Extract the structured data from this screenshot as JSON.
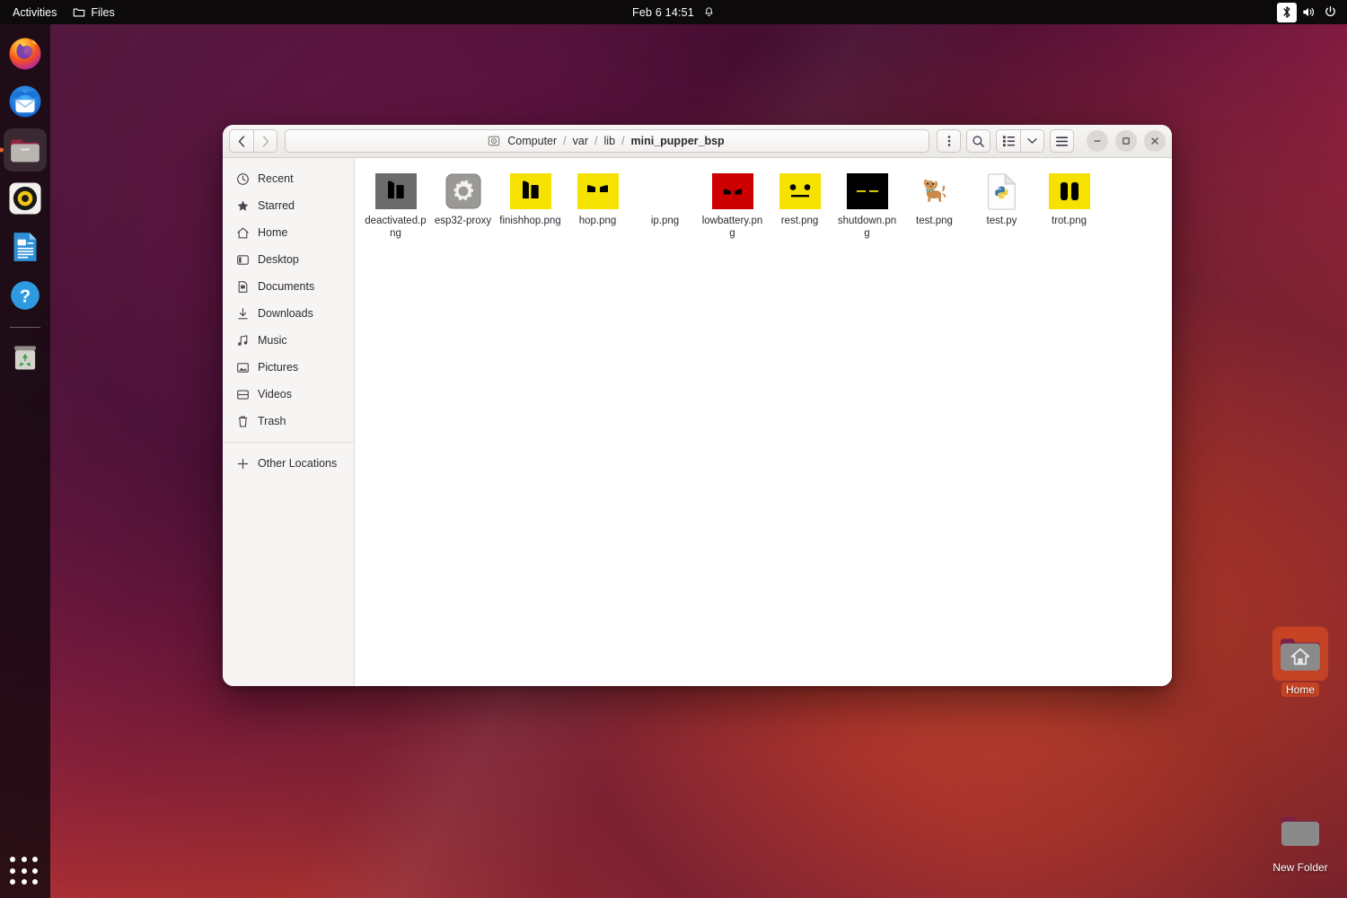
{
  "topbar": {
    "activities_label": "Activities",
    "app_name": "Files",
    "app_icon": "folder-icon",
    "clock": "Feb 6  14:51",
    "notification_icon": "bell-icon",
    "tray": [
      {
        "name": "bluetooth-icon",
        "active": true
      },
      {
        "name": "volume-icon",
        "active": false
      },
      {
        "name": "power-icon",
        "active": false
      }
    ]
  },
  "dock": {
    "items": [
      {
        "name": "firefox",
        "label": "Firefox",
        "running": false
      },
      {
        "name": "thunderbird",
        "label": "Thunderbird",
        "running": false
      },
      {
        "name": "files",
        "label": "Files",
        "running": true
      },
      {
        "name": "rhythmbox",
        "label": "Rhythmbox",
        "running": false
      },
      {
        "name": "libreoffice-writer",
        "label": "LibreOffice Writer",
        "running": false
      },
      {
        "name": "help",
        "label": "Help",
        "running": false
      },
      {
        "name": "trash",
        "label": "Trash",
        "running": false
      }
    ],
    "show_apps_label": "Show Applications"
  },
  "desktop_icons": [
    {
      "name": "home",
      "label": "Home",
      "selected": true
    },
    {
      "name": "new-folder",
      "label": "New Folder",
      "selected": false
    }
  ],
  "window": {
    "title": "mini_pupper_bsp",
    "nav": {
      "back_label": "‹",
      "forward_label": "›"
    },
    "pathbar": {
      "drive_icon": "computer-icon",
      "crumbs": [
        {
          "label": "Computer",
          "current": false
        },
        {
          "label": "var",
          "current": false
        },
        {
          "label": "lib",
          "current": false
        },
        {
          "label": "mini_pupper_bsp",
          "current": true
        }
      ],
      "separator": "/"
    },
    "toolbar": {
      "menu_icon": "vertical-dots-icon",
      "search_icon": "search-icon",
      "list_view_icon": "list-view-icon",
      "view_dropdown_icon": "chevron-down-icon",
      "hamburger_icon": "hamburger-menu-icon",
      "minimize_icon": "minimize-icon",
      "maximize_icon": "maximize-icon",
      "close_icon": "close-icon"
    }
  },
  "sidebar": {
    "items": [
      {
        "label": "Recent",
        "icon": "clock-icon"
      },
      {
        "label": "Starred",
        "icon": "star-icon"
      },
      {
        "label": "Home",
        "icon": "home-icon"
      },
      {
        "label": "Desktop",
        "icon": "desktop-icon"
      },
      {
        "label": "Documents",
        "icon": "document-icon"
      },
      {
        "label": "Downloads",
        "icon": "download-icon"
      },
      {
        "label": "Music",
        "icon": "music-note-icon"
      },
      {
        "label": "Pictures",
        "icon": "picture-icon"
      },
      {
        "label": "Videos",
        "icon": "video-icon"
      },
      {
        "label": "Trash",
        "icon": "trash-icon"
      }
    ],
    "other_locations": {
      "label": "Other Locations",
      "icon": "plus-icon"
    }
  },
  "files": [
    {
      "name": "deactivated.png",
      "thumb": "gray-two-blobs",
      "bg": "#6b6b6b"
    },
    {
      "name": "esp32-proxy",
      "thumb": "gear-folder-icon",
      "bg": "#9a9996"
    },
    {
      "name": "finishhop.png",
      "thumb": "yellow-two-blobs",
      "bg": "#f5e200"
    },
    {
      "name": "hop.png",
      "thumb": "yellow-two-brows",
      "bg": "#f5e200"
    },
    {
      "name": "ip.png",
      "thumb": "blank-white",
      "bg": "#ffffff"
    },
    {
      "name": "lowbattery.png",
      "thumb": "red-two-brows",
      "bg": "#cc0000"
    },
    {
      "name": "rest.png",
      "thumb": "yellow-face-rest",
      "bg": "#f5e200"
    },
    {
      "name": "shutdown.png",
      "thumb": "black-two-dashes",
      "bg": "#000000"
    },
    {
      "name": "test.png",
      "thumb": "dog-photo",
      "bg": "#ffffff"
    },
    {
      "name": "test.py",
      "thumb": "python-file-icon",
      "bg": "#ffffff"
    },
    {
      "name": "trot.png",
      "thumb": "yellow-two-bars",
      "bg": "#f5e200"
    }
  ],
  "colors": {
    "accent": "#e95420",
    "yellow": "#f5e200",
    "red": "#cc0000",
    "gray": "#6b6b6b",
    "black": "#000000",
    "headerbar": "#f6f5f4",
    "sidebar": "#f6f5f4",
    "topbar": "#0c0a0b"
  }
}
